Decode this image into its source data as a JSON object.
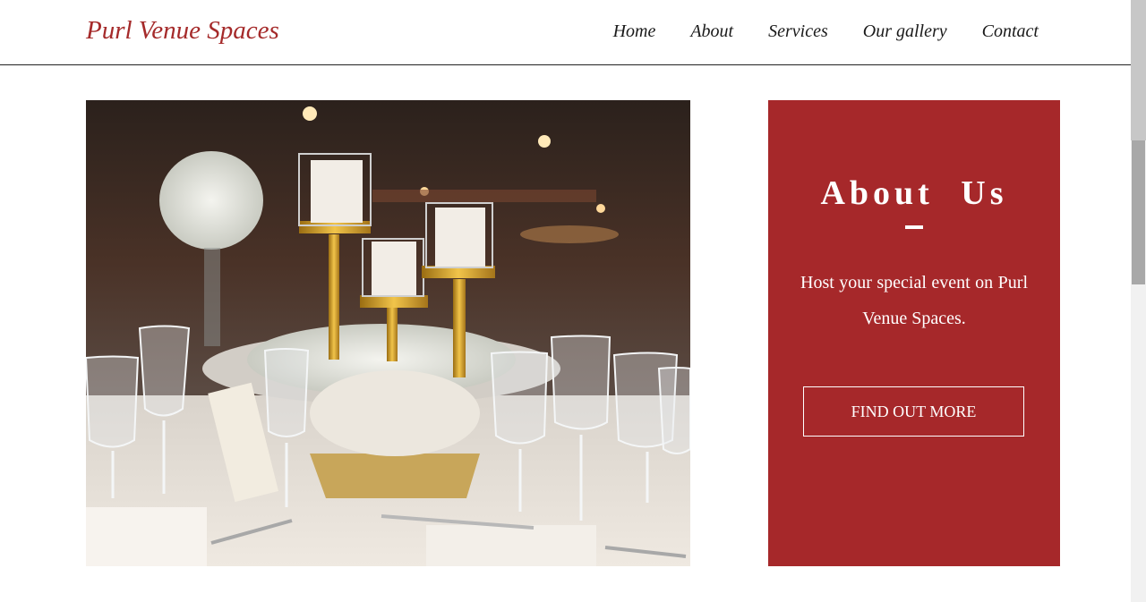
{
  "site": {
    "logo": "Purl Venue Spaces"
  },
  "nav": {
    "items": [
      {
        "label": "Home"
      },
      {
        "label": "About"
      },
      {
        "label": "Services"
      },
      {
        "label": "Our gallery"
      },
      {
        "label": "Contact"
      }
    ]
  },
  "about": {
    "title": "About Us",
    "text": "Host your special event on Purl Venue Spaces.",
    "button_label": "FIND OUT MORE",
    "background_color": "#a6282a"
  },
  "photo": {
    "subject": "banquet-table-with-candles"
  },
  "colors": {
    "brand": "#a52a2a",
    "panel": "#a6282a"
  }
}
